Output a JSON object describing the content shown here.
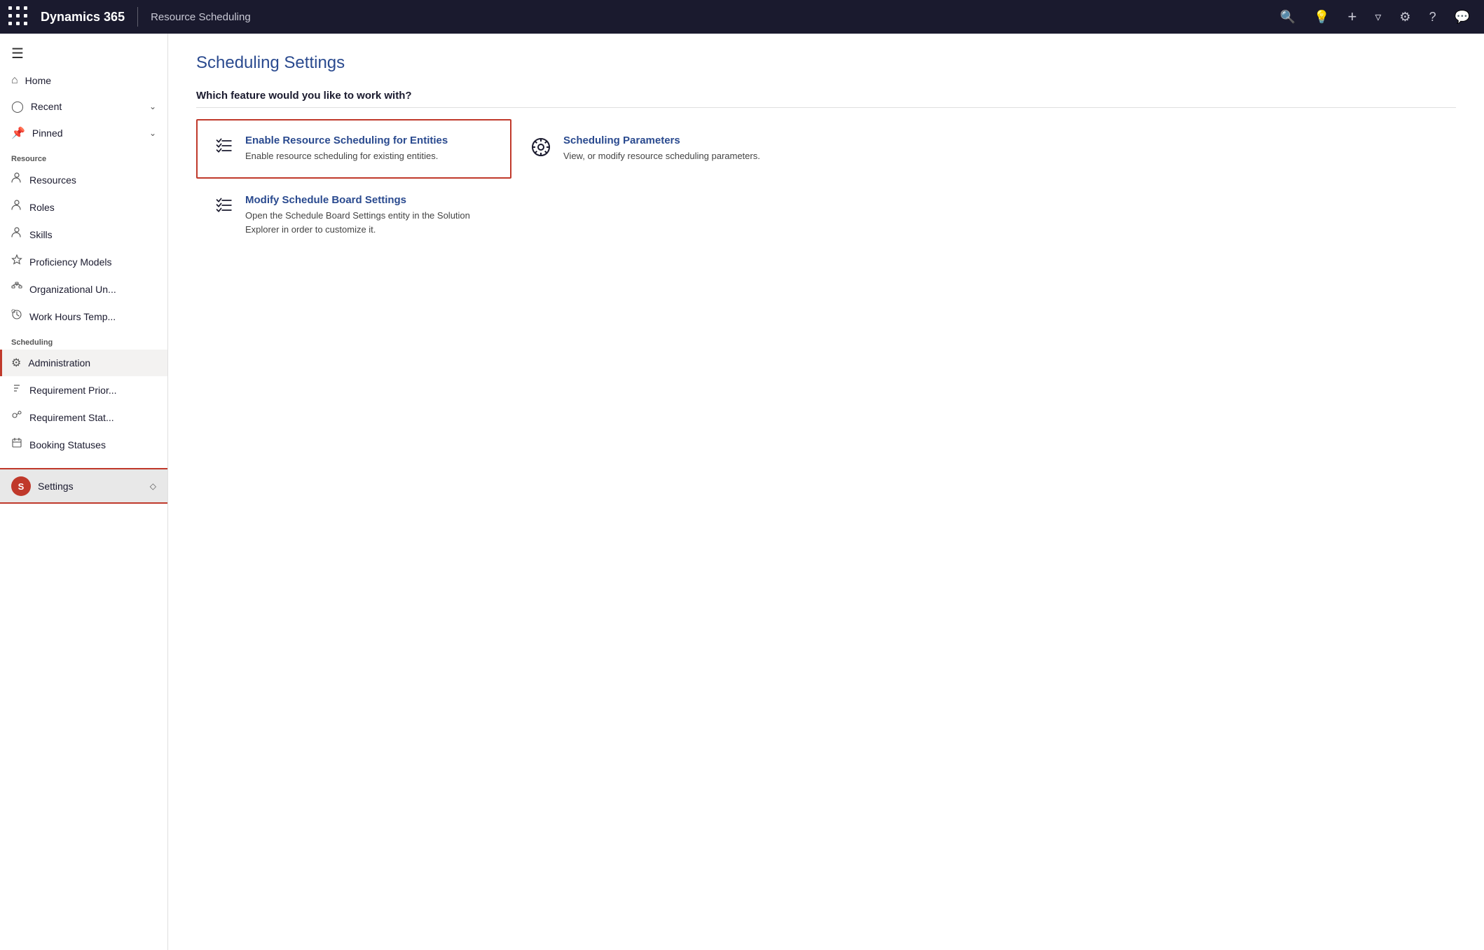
{
  "topnav": {
    "app_title": "Dynamics 365",
    "divider": "|",
    "module_name": "Resource Scheduling",
    "icons": {
      "search": "🔍",
      "lightbulb": "💡",
      "plus": "+",
      "filter": "⊽",
      "settings": "⚙",
      "help": "?",
      "chat": "💬"
    }
  },
  "sidebar": {
    "menu_label": "≡",
    "top_items": [
      {
        "id": "home",
        "icon": "🏠",
        "label": "Home",
        "has_arrow": false
      },
      {
        "id": "recent",
        "icon": "🕐",
        "label": "Recent",
        "has_arrow": true
      },
      {
        "id": "pinned",
        "icon": "📌",
        "label": "Pinned",
        "has_arrow": true
      }
    ],
    "resource_section_label": "Resource",
    "resource_items": [
      {
        "id": "resources",
        "icon": "👤",
        "label": "Resources",
        "has_arrow": false
      },
      {
        "id": "roles",
        "icon": "👤",
        "label": "Roles",
        "has_arrow": false
      },
      {
        "id": "skills",
        "icon": "👤",
        "label": "Skills",
        "has_arrow": false
      },
      {
        "id": "proficiency-models",
        "icon": "⭐",
        "label": "Proficiency Models",
        "has_arrow": false
      },
      {
        "id": "organizational-units",
        "icon": "🔗",
        "label": "Organizational Un...",
        "has_arrow": false
      },
      {
        "id": "work-hours-templates",
        "icon": "🕐",
        "label": "Work Hours Temp...",
        "has_arrow": false
      }
    ],
    "scheduling_section_label": "Scheduling",
    "scheduling_items": [
      {
        "id": "administration",
        "icon": "⚙",
        "label": "Administration",
        "has_arrow": false,
        "active": true
      },
      {
        "id": "requirement-priority",
        "icon": "↓↑",
        "label": "Requirement Prior...",
        "has_arrow": false
      },
      {
        "id": "requirement-status",
        "icon": "👥",
        "label": "Requirement Stat...",
        "has_arrow": false
      },
      {
        "id": "booking-statuses",
        "icon": "⚑",
        "label": "Booking Statuses",
        "has_arrow": false
      }
    ],
    "bottom_item": {
      "icon_letter": "S",
      "label": "Settings",
      "arrow": "◇"
    }
  },
  "main": {
    "page_title": "Scheduling Settings",
    "section_question": "Which feature would you like to work with?",
    "cards": [
      {
        "id": "enable-resource-scheduling",
        "icon_type": "checklist",
        "title": "Enable Resource Scheduling for Entities",
        "description": "Enable resource scheduling for existing entities.",
        "selected": true
      },
      {
        "id": "scheduling-parameters",
        "icon_type": "gear",
        "title": "Scheduling Parameters",
        "description": "View, or modify resource scheduling parameters.",
        "selected": false
      },
      {
        "id": "modify-schedule-board",
        "icon_type": "checklist",
        "title": "Modify Schedule Board Settings",
        "description": "Open the Schedule Board Settings entity in the Solution Explorer in order to customize it.",
        "selected": false
      }
    ]
  }
}
